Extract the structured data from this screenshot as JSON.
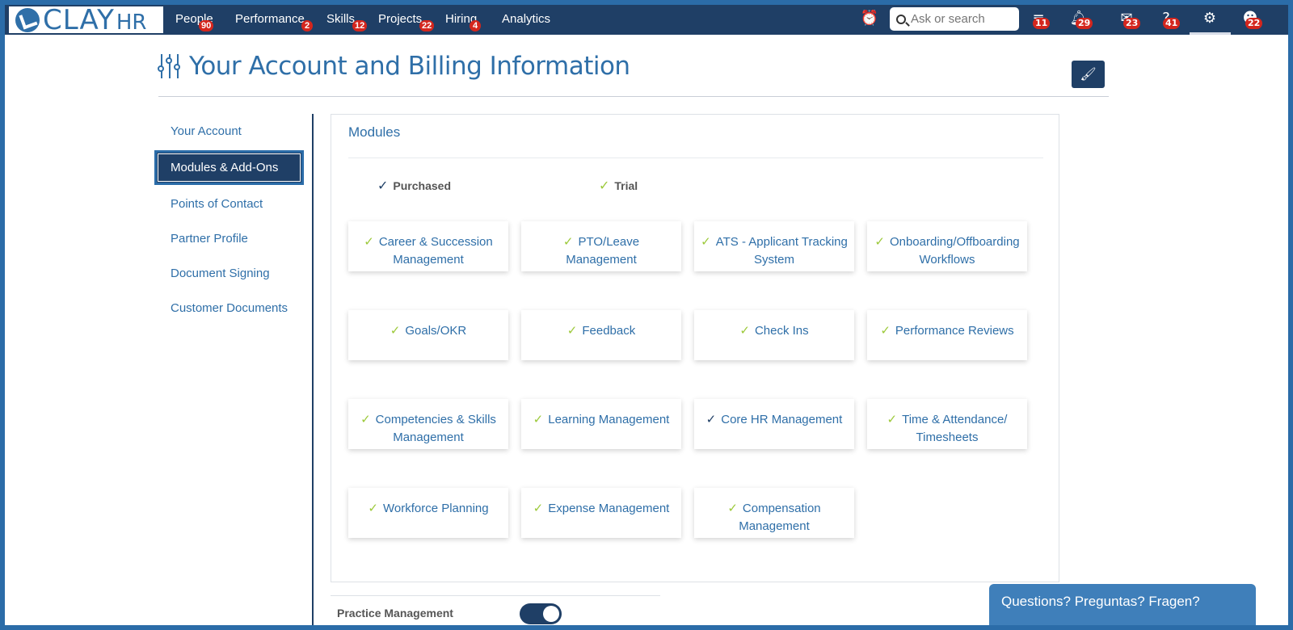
{
  "nav": {
    "logo_main": "CLAY",
    "logo_suffix": "HR",
    "items": [
      {
        "label": "People",
        "badge": "90"
      },
      {
        "label": "Performance",
        "badge": "2"
      },
      {
        "label": "Skills",
        "badge": "12"
      },
      {
        "label": "Projects",
        "badge": "22"
      },
      {
        "label": "Hiring",
        "badge": "4"
      },
      {
        "label": "Analytics",
        "badge": ""
      }
    ],
    "search_placeholder": "Ask or search",
    "icons": [
      {
        "name": "alarm-clock-icon",
        "badge": ""
      },
      {
        "name": "stack-icon",
        "badge": "11"
      },
      {
        "name": "bell-icon",
        "badge": "29"
      },
      {
        "name": "mail-icon",
        "badge": "23"
      },
      {
        "name": "help-icon",
        "badge": "41"
      },
      {
        "name": "gear-icon",
        "badge": ""
      },
      {
        "name": "avatar-icon",
        "badge": "22"
      }
    ]
  },
  "header": {
    "title": "Your Account and Billing Information",
    "brush_icon": "brush-icon"
  },
  "sidenav": {
    "items": [
      {
        "label": "Your Account",
        "active": false
      },
      {
        "label": "Modules & Add-Ons",
        "active": true
      },
      {
        "label": "Points of Contact",
        "active": false
      },
      {
        "label": "Partner Profile",
        "active": false
      },
      {
        "label": "Document Signing",
        "active": false
      },
      {
        "label": "Customer Documents",
        "active": false
      }
    ]
  },
  "modules": {
    "title": "Modules",
    "legend": {
      "purchased": "Purchased",
      "trial": "Trial"
    },
    "colors": {
      "purchased": "#1f3f66",
      "trial": "#9cc93a"
    },
    "cards": [
      {
        "label": "Career & Succession Management",
        "status": "trial"
      },
      {
        "label": "PTO/Leave Management",
        "status": "trial"
      },
      {
        "label": "ATS - Applicant Tracking System",
        "status": "trial"
      },
      {
        "label": "Onboarding/Offboarding Workflows",
        "status": "trial"
      },
      {
        "label": "Goals/OKR",
        "status": "trial"
      },
      {
        "label": "Feedback",
        "status": "trial"
      },
      {
        "label": "Check Ins",
        "status": "trial"
      },
      {
        "label": "Performance Reviews",
        "status": "trial"
      },
      {
        "label": "Competencies & Skills Management",
        "status": "trial"
      },
      {
        "label": "Learning Management",
        "status": "trial"
      },
      {
        "label": "Core HR Management",
        "status": "purchased"
      },
      {
        "label": "Time & Attendance/ Timesheets",
        "status": "trial"
      },
      {
        "label": "Workforce Planning",
        "status": "trial"
      },
      {
        "label": "Expense Management",
        "status": "trial"
      },
      {
        "label": "Compensation Management",
        "status": "trial"
      }
    ]
  },
  "practice": {
    "label": "Practice Management",
    "enabled": true
  },
  "chat": {
    "label": "Questions? Preguntas? Fragen?"
  }
}
